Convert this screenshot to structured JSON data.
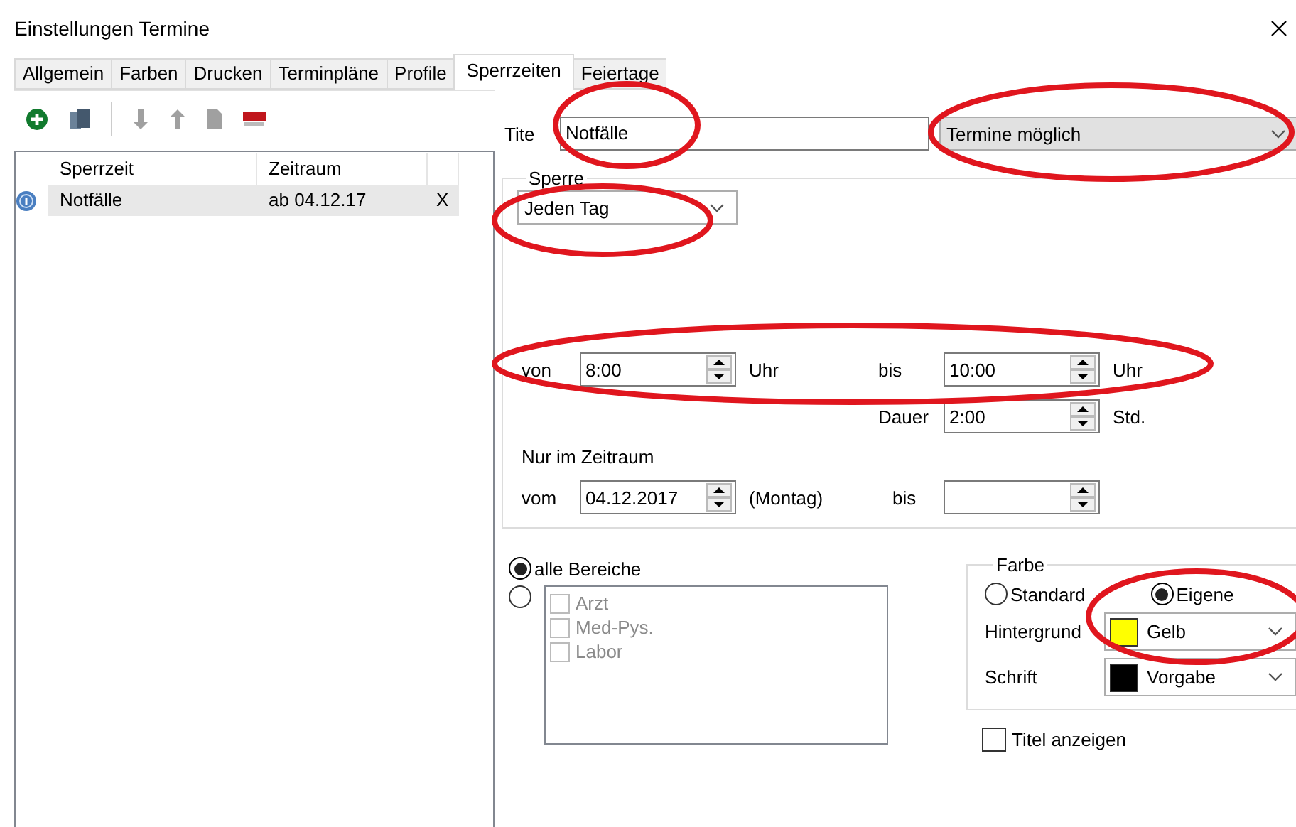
{
  "window": {
    "title": "Einstellungen Termine"
  },
  "tabs": [
    {
      "label": "Allgemein",
      "selected": false
    },
    {
      "label": "Farben",
      "selected": false
    },
    {
      "label": "Drucken",
      "selected": false
    },
    {
      "label": "Terminpläne",
      "selected": false
    },
    {
      "label": "Profile",
      "selected": false
    },
    {
      "label": "Sperrzeiten",
      "selected": true
    },
    {
      "label": "Feiertage",
      "selected": false
    }
  ],
  "list": {
    "columns": [
      "Sperrzeit",
      "Zeitraum"
    ],
    "rows": [
      {
        "name": "Notfälle",
        "period": "ab 04.12.17",
        "remove": "X",
        "selected": true
      }
    ]
  },
  "form": {
    "title_label": "Tite",
    "title_value": "Notfälle",
    "mode": "Termine möglich",
    "sperre": {
      "legend": "Sperre",
      "repeat": "Jeden Tag",
      "from_label": "von",
      "from": "8:00",
      "from_unit": "Uhr",
      "to_label": "bis",
      "to": "10:00",
      "to_unit": "Uhr",
      "duration_label": "Dauer",
      "duration": "2:00",
      "duration_unit": "Std.",
      "range_label": "Nur im Zeitraum",
      "range_from_label": "vom",
      "range_from": "04.12.2017",
      "range_weekday": "(Montag)",
      "range_to_label": "bis"
    }
  },
  "areas": {
    "options": [
      {
        "label": "alle Bereiche",
        "selected": true
      },
      {
        "selected": false
      }
    ],
    "items": [
      {
        "label": "Arzt",
        "checked": false,
        "disabled": true
      },
      {
        "label": "Med-Pys.",
        "checked": false,
        "disabled": true
      },
      {
        "label": "Labor",
        "checked": false,
        "disabled": true
      }
    ]
  },
  "color": {
    "legend": "Farbe",
    "options": [
      {
        "label": "Standard",
        "selected": false
      },
      {
        "label": "Eigene",
        "selected": true
      }
    ],
    "rows": [
      {
        "label": "Hintergrund",
        "value": "Gelb",
        "color": "#ffff00"
      },
      {
        "label": "Schrift",
        "value": "Vorgabe",
        "color": "#000000"
      }
    ]
  },
  "show_title": {
    "label": "Titel anzeigen",
    "checked": false
  }
}
